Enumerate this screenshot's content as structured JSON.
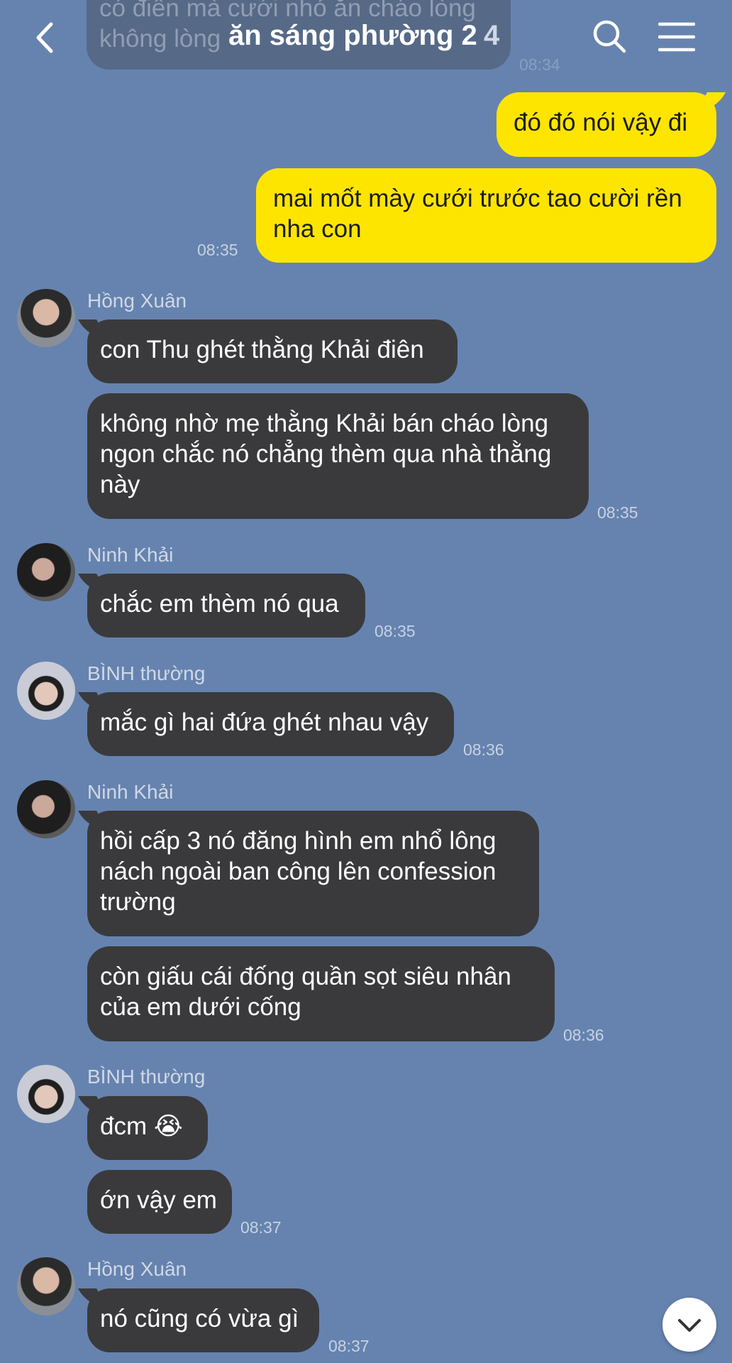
{
  "header": {
    "title": "ăn sáng phường 2",
    "member_count": "4",
    "back_icon": "chevron-left-icon",
    "search_icon": "search-icon",
    "menu_icon": "hamburger-menu-icon"
  },
  "faded_message": {
    "line1": "có điên mà cưới nhỏ ăn cháo lòng",
    "line2": "không lòng",
    "time": "08:34"
  },
  "messages": {
    "m1": {
      "text": "đó đó nói vậy đi"
    },
    "m2": {
      "text": "mai mốt mày cưới trước tao cười rền nha con",
      "time": "08:35"
    },
    "g1": {
      "sender": "Hồng Xuân",
      "m1": "con Thu ghét thằng Khải điên",
      "m2": "không nhờ mẹ thằng Khải bán cháo lòng ngon chắc nó chẳng thèm qua nhà thằng này",
      "time": "08:35"
    },
    "g2": {
      "sender": "Ninh Khải",
      "m1": "chắc em thèm nó qua",
      "time": "08:35"
    },
    "g3": {
      "sender": "BÌNH thường",
      "m1": "mắc gì hai đứa ghét nhau vậy",
      "time": "08:36"
    },
    "g4": {
      "sender": "Ninh Khải",
      "m1": "hồi cấp 3 nó đăng hình em nhổ lông nách ngoài ban công lên confession trường",
      "m2": "còn giấu cái đống quần sọt siêu nhân của em dưới cống",
      "time": "08:36"
    },
    "g5": {
      "sender": "BÌNH thường",
      "m1": "đcm 😭",
      "m2": "ớn vậy em",
      "time": "08:37"
    },
    "g6": {
      "sender": "Hồng Xuân",
      "m1": "nó cũng có vừa gì",
      "time": "08:37"
    }
  },
  "scroll_down_icon": "chevron-down-icon",
  "colors": {
    "background": "#6683af",
    "my_bubble": "#fee500",
    "their_bubble": "#3a3a3c"
  }
}
